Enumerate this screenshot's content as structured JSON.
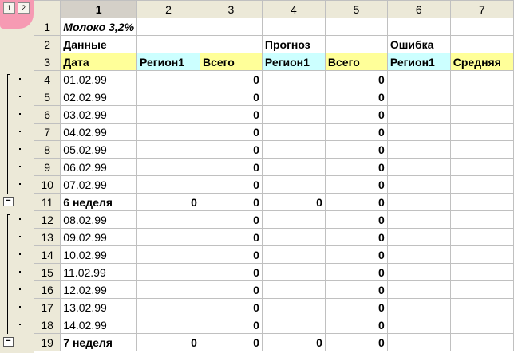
{
  "outline_levels": [
    "1",
    "2"
  ],
  "collapse_symbol": "−",
  "columns": [
    "1",
    "2",
    "3",
    "4",
    "5",
    "6",
    "7"
  ],
  "rows": [
    {
      "n": "1",
      "cells": [
        "Молоко 3,2%",
        "",
        "",
        "",
        "",
        "",
        ""
      ]
    },
    {
      "n": "2",
      "cells": [
        "Данные",
        "",
        "",
        "Прогноз",
        "",
        "Ошибка",
        ""
      ]
    },
    {
      "n": "3",
      "cells": [
        "Дата",
        "Регион1",
        "Всего",
        "Регион1",
        "Всего",
        "Регион1",
        "Средняя"
      ]
    },
    {
      "n": "4",
      "cells": [
        "01.02.99",
        "",
        "0",
        "",
        "0",
        "",
        ""
      ]
    },
    {
      "n": "5",
      "cells": [
        "02.02.99",
        "",
        "0",
        "",
        "0",
        "",
        ""
      ]
    },
    {
      "n": "6",
      "cells": [
        "03.02.99",
        "",
        "0",
        "",
        "0",
        "",
        ""
      ]
    },
    {
      "n": "7",
      "cells": [
        "04.02.99",
        "",
        "0",
        "",
        "0",
        "",
        ""
      ]
    },
    {
      "n": "8",
      "cells": [
        "05.02.99",
        "",
        "0",
        "",
        "0",
        "",
        ""
      ]
    },
    {
      "n": "9",
      "cells": [
        "06.02.99",
        "",
        "0",
        "",
        "0",
        "",
        ""
      ]
    },
    {
      "n": "10",
      "cells": [
        "07.02.99",
        "",
        "0",
        "",
        "0",
        "",
        ""
      ]
    },
    {
      "n": "11",
      "cells": [
        "6 неделя",
        "0",
        "0",
        "0",
        "0",
        "",
        ""
      ]
    },
    {
      "n": "12",
      "cells": [
        "08.02.99",
        "",
        "0",
        "",
        "0",
        "",
        ""
      ]
    },
    {
      "n": "13",
      "cells": [
        "09.02.99",
        "",
        "0",
        "",
        "0",
        "",
        ""
      ]
    },
    {
      "n": "14",
      "cells": [
        "10.02.99",
        "",
        "0",
        "",
        "0",
        "",
        ""
      ]
    },
    {
      "n": "15",
      "cells": [
        "11.02.99",
        "",
        "0",
        "",
        "0",
        "",
        ""
      ]
    },
    {
      "n": "16",
      "cells": [
        "12.02.99",
        "",
        "0",
        "",
        "0",
        "",
        ""
      ]
    },
    {
      "n": "17",
      "cells": [
        "13.02.99",
        "",
        "0",
        "",
        "0",
        "",
        ""
      ]
    },
    {
      "n": "18",
      "cells": [
        "14.02.99",
        "",
        "0",
        "",
        "0",
        "",
        ""
      ]
    },
    {
      "n": "19",
      "cells": [
        "7 неделя",
        "0",
        "0",
        "0",
        "0",
        "",
        ""
      ]
    }
  ],
  "colors": {
    "header_yellow": "#ffff99",
    "header_cyan": "#ccffff",
    "highlight": "#ff5a96"
  }
}
